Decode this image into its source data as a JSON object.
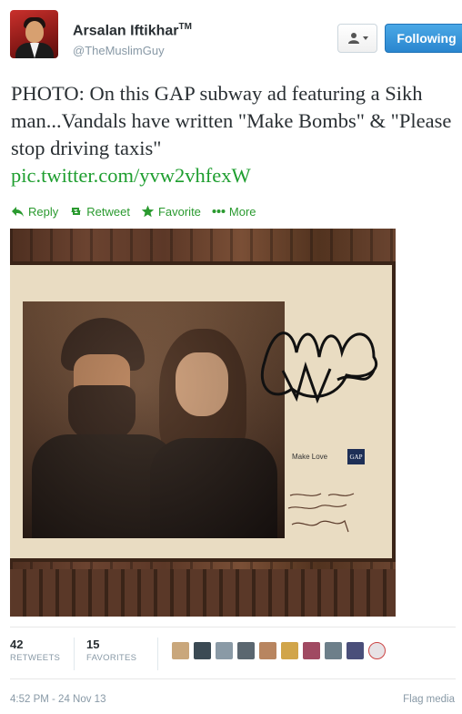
{
  "author": {
    "name": "Arsalan Iftikhar",
    "trademark": "TM",
    "handle": "@TheMuslimGuy"
  },
  "buttons": {
    "user_actions_icon": "person-icon",
    "follow_label": "Following",
    "follow_color": "#2a86cf"
  },
  "tweet": {
    "text": "PHOTO: On this GAP subway ad featuring a Sikh man...Vandals have written \"Make Bombs\" & \"Please stop driving taxis\"",
    "link": "pic.twitter.com/yvw2vhfexW",
    "link_color": "#1e9e2f"
  },
  "actions": [
    {
      "label": "Reply",
      "icon": "reply-icon"
    },
    {
      "label": "Retweet",
      "icon": "retweet-icon"
    },
    {
      "label": "Favorite",
      "icon": "star-icon"
    },
    {
      "label": "More",
      "icon": "more-dots-icon"
    }
  ],
  "photo": {
    "ad_text": "Make Love",
    "brand": "GAP",
    "graffiti_bombs": "Bombs!",
    "graffiti_taxis": "Please Stop Driving Taxis!"
  },
  "stats": {
    "retweets_count": "42",
    "retweets_label": "RETWEETS",
    "favorites_count": "15",
    "favorites_label": "FAVORITES"
  },
  "favoriters": [
    {
      "color": "#c9a77c"
    },
    {
      "color": "#3b4a54"
    },
    {
      "color": "#8a9aa6"
    },
    {
      "color": "#5b6770"
    },
    {
      "color": "#b88560"
    },
    {
      "color": "#d1a54a"
    },
    {
      "color": "#a04a62"
    },
    {
      "color": "#6d7f8a"
    },
    {
      "color": "#4a4f7a"
    },
    {
      "color": "#e7e2e5"
    }
  ],
  "footer": {
    "timestamp": "4:52 PM - 24 Nov 13",
    "flag": "Flag media"
  }
}
